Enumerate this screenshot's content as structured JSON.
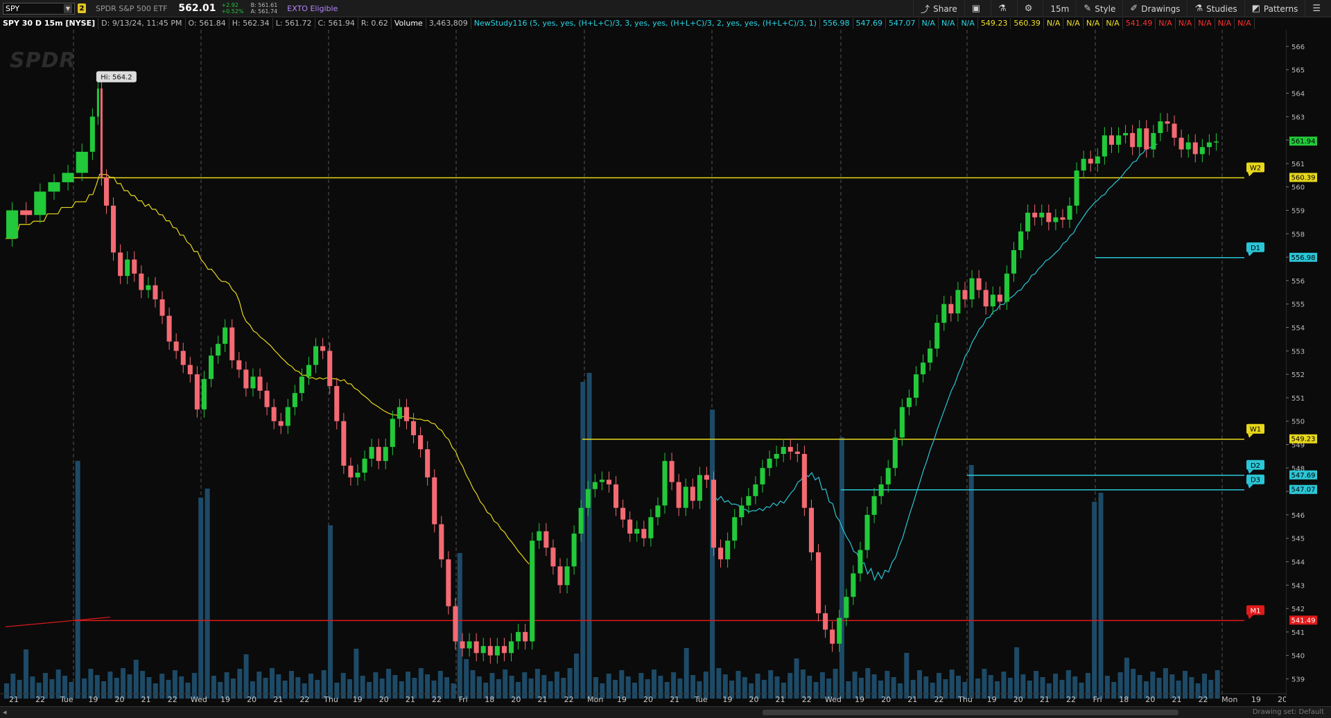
{
  "toolbar": {
    "symbol": "SPY",
    "link_badge": "2",
    "description": "SPDR S&P 500 ETF",
    "last_price": "562.01",
    "change": "+2.92",
    "change_pct": "+0.52%",
    "bid": "B: 561.61",
    "ask": "A: 561.74",
    "exto": "EXTO Eligible",
    "buttons": [
      {
        "label": "Share",
        "icon": "share-icon"
      },
      {
        "label": "",
        "icon": "snapshot-icon"
      },
      {
        "label": "",
        "icon": "beaker-icon"
      },
      {
        "label": "",
        "icon": "gear-icon"
      },
      {
        "label": "15m",
        "icon": ""
      },
      {
        "label": "Style",
        "icon": "style-icon"
      },
      {
        "label": "Drawings",
        "icon": "drawings-icon"
      },
      {
        "label": "Studies",
        "icon": "studies-icon"
      },
      {
        "label": "Patterns",
        "icon": "patterns-icon"
      },
      {
        "label": "",
        "icon": "menu-icon"
      }
    ]
  },
  "infobar": {
    "title": "SPY 30 D 15m [NYSE]",
    "date": "D: 9/13/24, 11:45 PM",
    "open": "O: 561.84",
    "high": "H: 562.34",
    "low": "L: 561.72",
    "close": "C: 561.94",
    "range": "R: 0.62",
    "volume_label": "Volume",
    "volume_value": "3,463,809",
    "study": "NewStudy116 (5, yes, yes, (H+L+C)/3, 3, yes, yes, (H+L+C)/3, 2, yes, yes, (H+L+C)/3, 1)",
    "study_values": [
      {
        "v": "556.98",
        "c": "cyan"
      },
      {
        "v": "547.69",
        "c": "cyan"
      },
      {
        "v": "547.07",
        "c": "cyan"
      },
      {
        "v": "N/A",
        "c": "cyan"
      },
      {
        "v": "N/A",
        "c": "cyan"
      },
      {
        "v": "N/A",
        "c": "cyan"
      },
      {
        "v": "549.23",
        "c": "yellow"
      },
      {
        "v": "560.39",
        "c": "yellow"
      },
      {
        "v": "N/A",
        "c": "yellow"
      },
      {
        "v": "N/A",
        "c": "yellow"
      },
      {
        "v": "N/A",
        "c": "yellow"
      },
      {
        "v": "N/A",
        "c": "yellow"
      },
      {
        "v": "541.49",
        "c": "red"
      },
      {
        "v": "N/A",
        "c": "red"
      },
      {
        "v": "N/A",
        "c": "red"
      },
      {
        "v": "N/A",
        "c": "red"
      },
      {
        "v": "N/A",
        "c": "red"
      },
      {
        "v": "N/A",
        "c": "red"
      }
    ]
  },
  "watermark": "SPDR",
  "high_label": "Hi: 564.2",
  "bottom": {
    "drawing_set": "Drawing set: Default"
  },
  "colors": {
    "bg": "#0b0b0b",
    "up": "#22c93a",
    "down": "#f46a73",
    "volume": "#1d4a66",
    "yellow": "#e8d81c",
    "cyan": "#2bc6d6",
    "red": "#e01a1a",
    "grid": "#4a4a4a"
  },
  "chart_data": {
    "type": "candlestick",
    "ylim": [
      538.6,
      566.5
    ],
    "y_ticks": [
      "566",
      "565",
      "564",
      "563",
      "562",
      "561",
      "560",
      "559",
      "558",
      "557",
      "556",
      "555",
      "554",
      "553",
      "552",
      "551",
      "550",
      "549",
      "548",
      "547",
      "546",
      "545",
      "544",
      "543",
      "542",
      "541",
      "540",
      "539"
    ],
    "x_labels": [
      "21",
      "22",
      "Tue",
      "19",
      "20",
      "21",
      "22",
      "Wed",
      "19",
      "20",
      "21",
      "22",
      "Thu",
      "19",
      "20",
      "21",
      "22",
      "Fri",
      "18",
      "20",
      "21",
      "22",
      "Mon",
      "19",
      "20",
      "21",
      "Tue",
      "19",
      "20",
      "21",
      "22",
      "Wed",
      "19",
      "20",
      "21",
      "22",
      "Thu",
      "19",
      "20",
      "21",
      "22",
      "Fri",
      "18",
      "20",
      "21",
      "22",
      "Mon",
      "19",
      "20"
    ],
    "session_breaks": [
      "Tue",
      "Wed",
      "Thu",
      "Fri",
      "Mon",
      "Tue",
      "Wed",
      "Thu",
      "Fri",
      "Mon"
    ],
    "close_path": [
      [
        0,
        557.8
      ],
      [
        4,
        559.0
      ],
      [
        8,
        558.8
      ],
      [
        12,
        559.8
      ],
      [
        16,
        560.2
      ],
      [
        20,
        560.6
      ],
      [
        24,
        561.5
      ],
      [
        26,
        563.0
      ],
      [
        27,
        564.2
      ],
      [
        28,
        560.4
      ],
      [
        30,
        559.2
      ],
      [
        32,
        557.2
      ],
      [
        34,
        556.2
      ],
      [
        36,
        556.9
      ],
      [
        38,
        556.3
      ],
      [
        40,
        555.6
      ],
      [
        42,
        555.8
      ],
      [
        44,
        555.2
      ],
      [
        46,
        554.5
      ],
      [
        48,
        553.4
      ],
      [
        50,
        553.0
      ],
      [
        52,
        552.4
      ],
      [
        54,
        552.0
      ],
      [
        56,
        550.5
      ],
      [
        58,
        551.8
      ],
      [
        60,
        552.8
      ],
      [
        62,
        553.3
      ],
      [
        64,
        554.0
      ],
      [
        66,
        552.6
      ],
      [
        68,
        552.2
      ],
      [
        70,
        551.4
      ],
      [
        72,
        551.9
      ],
      [
        74,
        551.3
      ],
      [
        76,
        550.6
      ],
      [
        78,
        550.0
      ],
      [
        80,
        549.8
      ],
      [
        82,
        550.6
      ],
      [
        84,
        551.2
      ],
      [
        86,
        551.9
      ],
      [
        88,
        552.4
      ],
      [
        90,
        553.2
      ],
      [
        92,
        553.0
      ],
      [
        94,
        551.5
      ],
      [
        96,
        550.0
      ],
      [
        98,
        548.1
      ],
      [
        100,
        547.6
      ],
      [
        102,
        547.8
      ],
      [
        104,
        548.4
      ],
      [
        106,
        548.9
      ],
      [
        108,
        548.3
      ],
      [
        110,
        548.9
      ],
      [
        112,
        550.1
      ],
      [
        114,
        550.6
      ],
      [
        116,
        550.0
      ],
      [
        118,
        549.4
      ],
      [
        120,
        548.8
      ],
      [
        122,
        547.6
      ],
      [
        124,
        545.6
      ],
      [
        126,
        544.1
      ],
      [
        128,
        542.1
      ],
      [
        130,
        540.6
      ],
      [
        132,
        540.3
      ],
      [
        134,
        540.6
      ],
      [
        136,
        540.1
      ],
      [
        138,
        540.4
      ],
      [
        140,
        540.0
      ],
      [
        142,
        540.4
      ],
      [
        144,
        540.1
      ],
      [
        146,
        540.6
      ],
      [
        148,
        541.0
      ],
      [
        150,
        540.6
      ],
      [
        152,
        544.9
      ],
      [
        154,
        545.3
      ],
      [
        156,
        544.6
      ],
      [
        158,
        543.8
      ],
      [
        160,
        543.0
      ],
      [
        162,
        543.8
      ],
      [
        164,
        545.2
      ],
      [
        166,
        546.3
      ],
      [
        168,
        547.1
      ],
      [
        170,
        547.4
      ],
      [
        172,
        547.5
      ],
      [
        174,
        547.3
      ],
      [
        176,
        546.3
      ],
      [
        178,
        545.8
      ],
      [
        180,
        545.2
      ],
      [
        182,
        545.4
      ],
      [
        184,
        545.0
      ],
      [
        186,
        545.9
      ],
      [
        188,
        546.4
      ],
      [
        190,
        548.3
      ],
      [
        192,
        547.4
      ],
      [
        194,
        546.3
      ],
      [
        196,
        547.2
      ],
      [
        198,
        546.6
      ],
      [
        200,
        547.7
      ],
      [
        202,
        547.5
      ],
      [
        204,
        544.6
      ],
      [
        206,
        544.1
      ],
      [
        208,
        544.9
      ],
      [
        210,
        545.9
      ],
      [
        212,
        546.4
      ],
      [
        214,
        546.8
      ],
      [
        216,
        547.3
      ],
      [
        218,
        548.0
      ],
      [
        220,
        548.4
      ],
      [
        222,
        548.6
      ],
      [
        224,
        548.9
      ],
      [
        226,
        548.7
      ],
      [
        228,
        548.6
      ],
      [
        230,
        546.3
      ],
      [
        232,
        544.4
      ],
      [
        234,
        541.8
      ],
      [
        236,
        541.1
      ],
      [
        238,
        540.5
      ],
      [
        240,
        541.6
      ],
      [
        242,
        542.5
      ],
      [
        244,
        543.5
      ],
      [
        246,
        544.5
      ],
      [
        248,
        546.0
      ],
      [
        250,
        546.8
      ],
      [
        252,
        547.3
      ],
      [
        254,
        548.0
      ],
      [
        256,
        549.3
      ],
      [
        258,
        550.6
      ],
      [
        260,
        551.0
      ],
      [
        262,
        552.0
      ],
      [
        264,
        552.5
      ],
      [
        266,
        553.1
      ],
      [
        268,
        554.2
      ],
      [
        270,
        555.0
      ],
      [
        272,
        554.6
      ],
      [
        274,
        555.6
      ],
      [
        276,
        555.2
      ],
      [
        278,
        556.1
      ],
      [
        280,
        555.6
      ],
      [
        282,
        554.9
      ],
      [
        284,
        555.4
      ],
      [
        286,
        555.1
      ],
      [
        288,
        556.3
      ],
      [
        290,
        557.3
      ],
      [
        292,
        558.1
      ],
      [
        294,
        558.9
      ],
      [
        296,
        558.7
      ],
      [
        298,
        558.9
      ],
      [
        300,
        558.5
      ],
      [
        302,
        558.7
      ],
      [
        304,
        558.6
      ],
      [
        306,
        559.2
      ],
      [
        308,
        560.7
      ],
      [
        310,
        561.2
      ],
      [
        312,
        561.0
      ],
      [
        314,
        561.3
      ],
      [
        316,
        562.2
      ],
      [
        318,
        561.8
      ],
      [
        320,
        562.2
      ],
      [
        322,
        562.3
      ],
      [
        324,
        561.7
      ],
      [
        326,
        562.5
      ],
      [
        328,
        561.6
      ],
      [
        330,
        562.3
      ],
      [
        332,
        562.8
      ],
      [
        334,
        562.7
      ],
      [
        336,
        562.1
      ],
      [
        338,
        561.6
      ],
      [
        340,
        561.9
      ],
      [
        342,
        561.4
      ],
      [
        344,
        561.7
      ],
      [
        346,
        561.9
      ],
      [
        348,
        561.94
      ]
    ],
    "levels": [
      {
        "name": "W2",
        "value": 560.39,
        "color": "yellow"
      },
      {
        "name": "D1",
        "value": 556.98,
        "color": "cyan"
      },
      {
        "name": "W1",
        "value": 549.23,
        "color": "yellow"
      },
      {
        "name": "D2",
        "value": 547.69,
        "color": "cyan"
      },
      {
        "name": "D3",
        "value": 547.07,
        "color": "cyan"
      },
      {
        "name": "M1",
        "value": 541.49,
        "color": "red"
      }
    ],
    "level_value_labels": [
      "560.39",
      "556.98",
      "549.23",
      "547.69",
      "547.07",
      "541.49"
    ],
    "current_price_label": "561.94"
  }
}
